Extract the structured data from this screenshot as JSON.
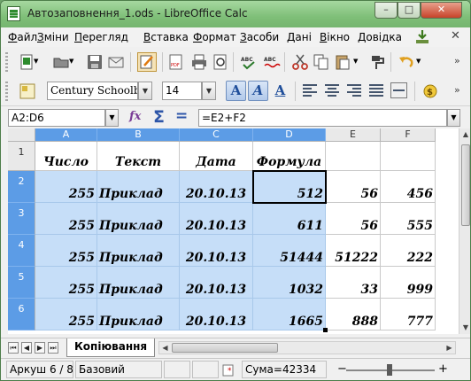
{
  "window": {
    "title": "Автозаповнення_1.ods - LibreOffice Calc",
    "minimize_label": "–",
    "maximize_label": "□",
    "close_label": "✕"
  },
  "menu": {
    "items": [
      {
        "label": "Файл",
        "u": "Ф",
        "rest": "айл"
      },
      {
        "label": "Зміни",
        "u": "З",
        "rest": "міни"
      },
      {
        "label": "Перегляд",
        "u": "П",
        "rest": "ерегляд"
      },
      {
        "label": "Вставка",
        "u": "В",
        "rest": "ставка"
      },
      {
        "label": "Формат",
        "u": "Ф",
        "rest": "ормат"
      },
      {
        "label": "Засоби",
        "u": "З",
        "rest": "асоби"
      },
      {
        "label": "Дані",
        "u": "Д",
        "rest": "ані"
      },
      {
        "label": "Вікно",
        "u": "В",
        "rest": "ікно"
      },
      {
        "label": "Довідка",
        "u": "Д",
        "rest": "овідка"
      }
    ],
    "close_doc": "✕"
  },
  "formatting": {
    "font_name": "Century Schoolboo",
    "font_size": "14",
    "bold_glyph": "A",
    "italic_glyph": "A",
    "underline_glyph": "A"
  },
  "formula_bar": {
    "cell_ref": "A2:D6",
    "fx": "fx",
    "sum": "Σ",
    "equals": "=",
    "formula": "=E2+F2"
  },
  "grid": {
    "columns": [
      "A",
      "B",
      "C",
      "D",
      "E",
      "F"
    ],
    "selected_columns": [
      "A",
      "B",
      "C",
      "D"
    ],
    "rows": [
      "1",
      "2",
      "3",
      "4",
      "5",
      "6"
    ],
    "selected_rows": [
      "2",
      "3",
      "4",
      "5",
      "6"
    ],
    "header_row": [
      "Число",
      "Текст",
      "Дата",
      "Формула",
      "",
      ""
    ],
    "data_rows": [
      [
        "255",
        "Приклад",
        "20.10.13",
        "512",
        "56",
        "456"
      ],
      [
        "255",
        "Приклад",
        "20.10.13",
        "611",
        "56",
        "555"
      ],
      [
        "255",
        "Приклад",
        "20.10.13",
        "51444",
        "51222",
        "222"
      ],
      [
        "255",
        "Приклад",
        "20.10.13",
        "1032",
        "33",
        "999"
      ],
      [
        "255",
        "Приклад",
        "20.10.13",
        "1665",
        "888",
        "777"
      ]
    ]
  },
  "sheets": {
    "active_tab": "Копіювання"
  },
  "status": {
    "sheet_position": "Аркуш 6 / 8",
    "page_style": "Базовий",
    "sum": "Сума=42334",
    "zoom_minus": "−",
    "zoom_plus": "+"
  }
}
